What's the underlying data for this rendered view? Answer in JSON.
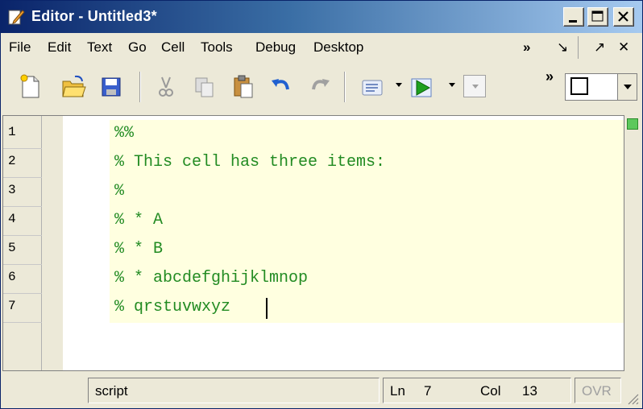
{
  "window": {
    "title": "Editor - Untitled3*"
  },
  "menu": [
    "File",
    "Edit",
    "Text",
    "Go",
    "Cell",
    "Tools",
    "Debug",
    "Desktop"
  ],
  "menu_extra": {
    "more": "»",
    "dock": "↘",
    "undock": "↗",
    "close": "✕"
  },
  "toolbar": {
    "overflow": "»"
  },
  "editor": {
    "line_numbers": [
      "1",
      "2",
      "3",
      "4",
      "5",
      "6",
      "7"
    ],
    "lines": [
      "%%",
      "% This cell has three items:",
      "%",
      "% * A",
      "% * B",
      "% * abcdefghijklmnop",
      "% qrstuvwxyz"
    ],
    "comment_color": "#228b22",
    "cell_highlight_color": "#ffffe0"
  },
  "status": {
    "mode": "script",
    "ln_label": "Ln",
    "ln_value": "7",
    "col_label": "Col",
    "col_value": "13",
    "ovr": "OVR"
  }
}
